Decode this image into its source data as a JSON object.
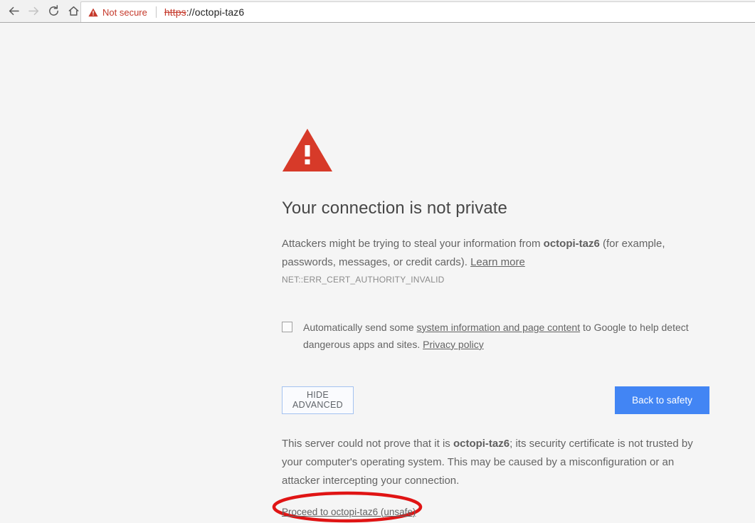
{
  "browser": {
    "nav": [
      {
        "name": "back",
        "icon": "arrow-left-icon",
        "enabled": true
      },
      {
        "name": "forward",
        "icon": "arrow-right-icon",
        "enabled": false
      },
      {
        "name": "reload",
        "icon": "reload-icon",
        "enabled": true
      },
      {
        "name": "home",
        "icon": "home-icon",
        "enabled": true
      }
    ],
    "omnibox": {
      "security_label": "Not secure",
      "security_icon": "warning-triangle-icon",
      "url_scheme": "https",
      "url_rest": "://octopi-taz6",
      "full_url": "https://octopi-taz6"
    }
  },
  "interstitial": {
    "icon": "warning-triangle-icon",
    "title": "Your connection is not private",
    "paragraph_prefix": "Attackers might be trying to steal your information from ",
    "host": "octopi-taz6",
    "paragraph_suffix": " (for example, passwords, messages, or credit cards). ",
    "learn_more_label": "Learn more",
    "error_code": "NET::ERR_CERT_AUTHORITY_INVALID",
    "optin": {
      "checked": false,
      "text_prefix": "Automatically send some ",
      "link1_label": "system information and page content",
      "text_middle": " to Google to help detect dangerous apps and sites. ",
      "link2_label": "Privacy policy"
    },
    "buttons": {
      "hide_advanced_label": "HIDE ADVANCED",
      "back_to_safety_label": "Back to safety"
    },
    "advanced": {
      "text_prefix": "This server could not prove that it is ",
      "host": "octopi-taz6",
      "text_suffix": "; its security certificate is not trusted by your computer's operating system. This may be caused by a misconfiguration or an attacker intercepting your connection.",
      "proceed_link_label": "Proceed to octopi-taz6 (unsafe)"
    }
  },
  "annotation": {
    "shape": "ellipse",
    "color": "#e01414",
    "target": "proceed-link"
  },
  "colors": {
    "page_background": "#f5f5f5",
    "warning_red": "#d73a29",
    "primary_blue": "#4285f4",
    "annotation_red": "#e01414",
    "body_text": "#646464"
  }
}
